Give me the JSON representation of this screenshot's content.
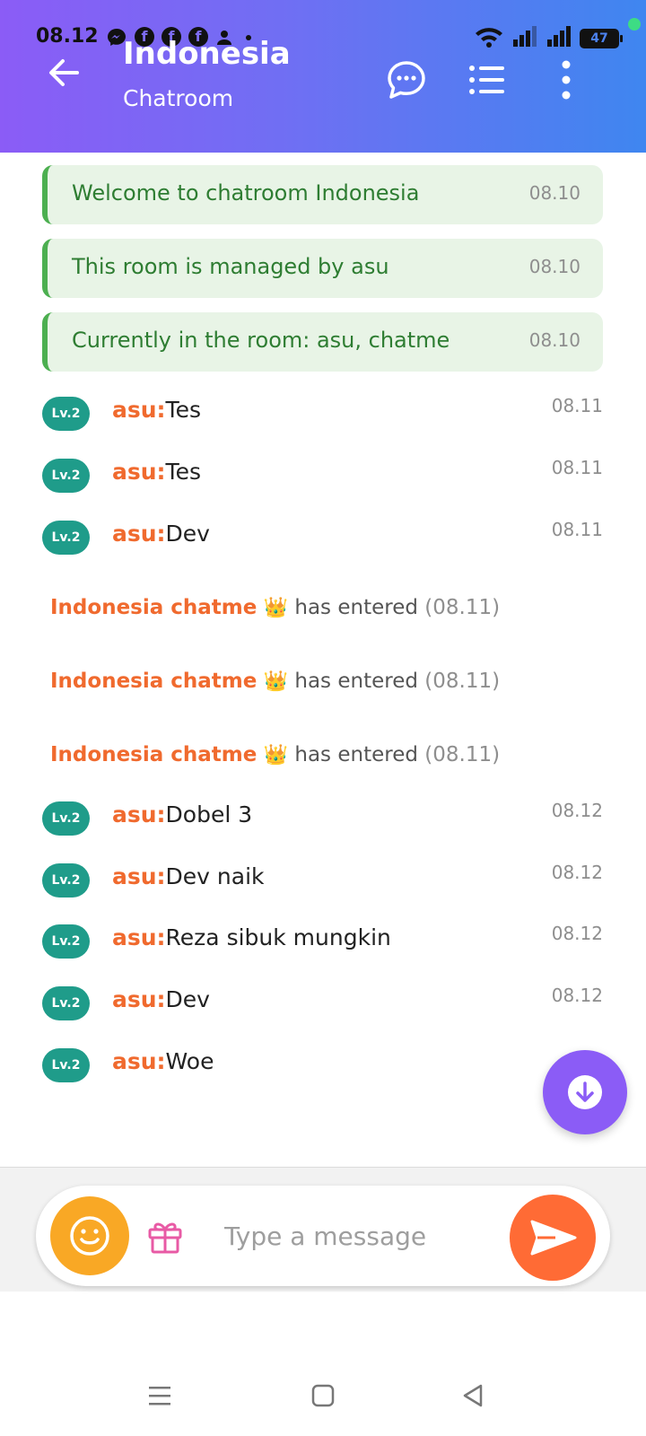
{
  "status_bar": {
    "time": "08.12",
    "battery": "47"
  },
  "header": {
    "title": "Indonesia",
    "subtitle": "Chatroom",
    "icons": [
      "back-arrow-icon",
      "chat-bubble-icon",
      "list-icon",
      "more-vertical-icon"
    ]
  },
  "system_messages": [
    {
      "text": "Welcome to chatroom Indonesia",
      "time": "08.10"
    },
    {
      "text": "This room is managed by asu",
      "time": "08.10"
    },
    {
      "text": "Currently in the room: asu, chatme",
      "time": "08.10"
    }
  ],
  "chat_messages_1": [
    {
      "level": "Lv.2",
      "user": "asu:",
      "text": "Tes",
      "time": "08.11"
    },
    {
      "level": "Lv.2",
      "user": "asu:",
      "text": "Tes",
      "time": "08.11"
    },
    {
      "level": "Lv.2",
      "user": "asu:",
      "text": "Dev",
      "time": "08.11"
    }
  ],
  "entered_events": [
    {
      "name": "Indonesia chatme",
      "crown": "👑",
      "text": "has entered",
      "time": "(08.11)"
    },
    {
      "name": "Indonesia chatme",
      "crown": "👑",
      "text": "has entered",
      "time": "(08.11)"
    },
    {
      "name": "Indonesia chatme",
      "crown": "👑",
      "text": "has entered",
      "time": "(08.11)"
    }
  ],
  "chat_messages_2": [
    {
      "level": "Lv.2",
      "user": "asu:",
      "text": "Dobel 3",
      "time": "08.12"
    },
    {
      "level": "Lv.2",
      "user": "asu:",
      "text": "Dev naik",
      "time": "08.12"
    },
    {
      "level": "Lv.2",
      "user": "asu:",
      "text": "Reza sibuk mungkin",
      "time": "08.12"
    },
    {
      "level": "Lv.2",
      "user": "asu:",
      "text": "Dev",
      "time": "08.12"
    },
    {
      "level": "Lv.2",
      "user": "asu:",
      "text": "Woe",
      "time": ""
    }
  ],
  "composer": {
    "placeholder": "Type a message",
    "icons": [
      "emoji-icon",
      "gift-icon",
      "send-icon"
    ]
  },
  "colors": {
    "header_start": "#8b5cf6",
    "header_end": "#3f86f0",
    "system_text": "#2e7d32",
    "username": "#f06a2e",
    "level_badge": "#1f9c8a",
    "send_button": "#ff6b35",
    "emoji_button": "#f9a825"
  }
}
